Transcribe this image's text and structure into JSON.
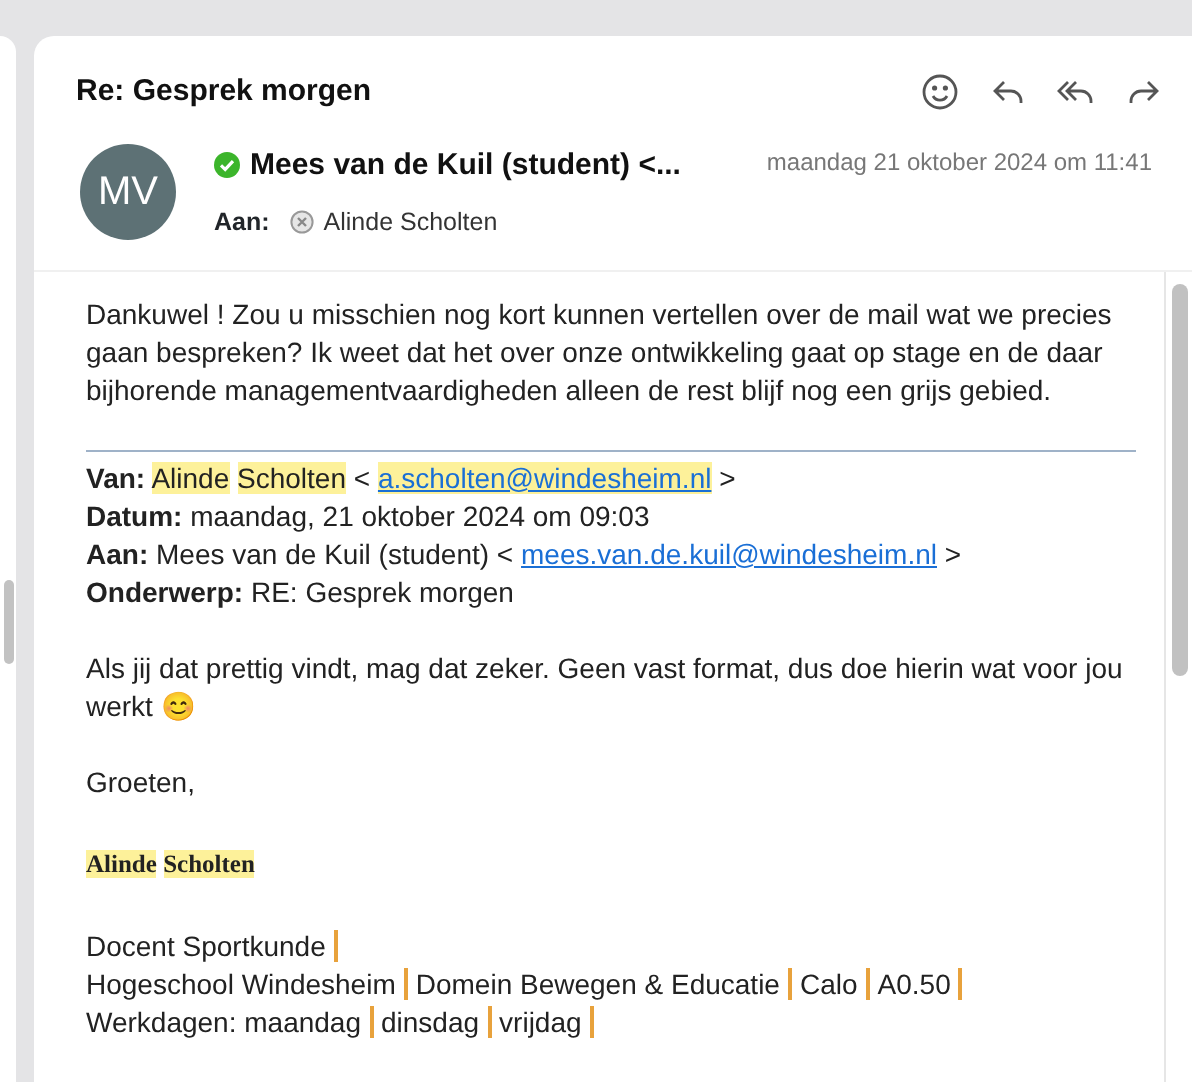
{
  "message": {
    "subject": "Re: Gesprek morgen",
    "avatar_initials": "MV",
    "sender": "Mees van de Kuil (student) <...",
    "sender_verified": true,
    "date": "maandag 21 oktober 2024 om 11:41",
    "to_label": "Aan:",
    "recipients": [
      {
        "name": "Alinde Scholten"
      }
    ]
  },
  "body": {
    "reply": "Dankuwel ! Zou u misschien nog kort kunnen vertellen over de mail wat we precies gaan bespreken? Ik weet dat het over onze ontwikkeling gaat op stage en de daar bijhorende managementvaardigheden alleen de rest blijf nog een grijs gebied.",
    "quoted_header": [
      {
        "label": "Van:",
        "parts": [
          {
            "kind": "text",
            "text": "Alinde",
            "highlighted": true
          },
          {
            "kind": "text",
            "text": "Scholten",
            "highlighted": true
          },
          {
            "kind": "text",
            "text": "<",
            "highlighted": false
          },
          {
            "kind": "link",
            "text": "a.scholten@windesheim.nl",
            "highlighted": true
          },
          {
            "kind": "text",
            "text": ">",
            "highlighted": false
          }
        ]
      },
      {
        "label": "Datum:",
        "parts": [
          {
            "kind": "text",
            "text": "maandag, 21 oktober 2024 om 09:03",
            "highlighted": false
          }
        ]
      },
      {
        "label": "Aan:",
        "parts": [
          {
            "kind": "text",
            "text": "Mees van de Kuil (student) <",
            "highlighted": false
          },
          {
            "kind": "link",
            "text": "mees.van.de.kuil@windesheim.nl",
            "highlighted": false
          },
          {
            "kind": "text",
            "text": ">",
            "highlighted": false
          }
        ]
      },
      {
        "label": "Onderwerp:",
        "parts": [
          {
            "kind": "text",
            "text": "RE: Gesprek morgen",
            "highlighted": false
          }
        ]
      }
    ],
    "quoted_text": "Als jij dat prettig vindt, mag dat zeker. Geen vast format, dus doe hierin wat voor jou werkt 😊",
    "greeting": "Groeten,",
    "signature_name": [
      {
        "text": "Alinde",
        "highlighted": true
      },
      {
        "text": "Scholten",
        "highlighted": true
      }
    ],
    "signature_lines": [
      [
        "Docent Sportkunde"
      ],
      [
        "Hogeschool Windesheim",
        "Domein Bewegen & Educatie",
        "Calo",
        "A0.50"
      ],
      [
        "Werkdagen: maandag",
        "dinsdag",
        "vrijdag"
      ]
    ]
  }
}
